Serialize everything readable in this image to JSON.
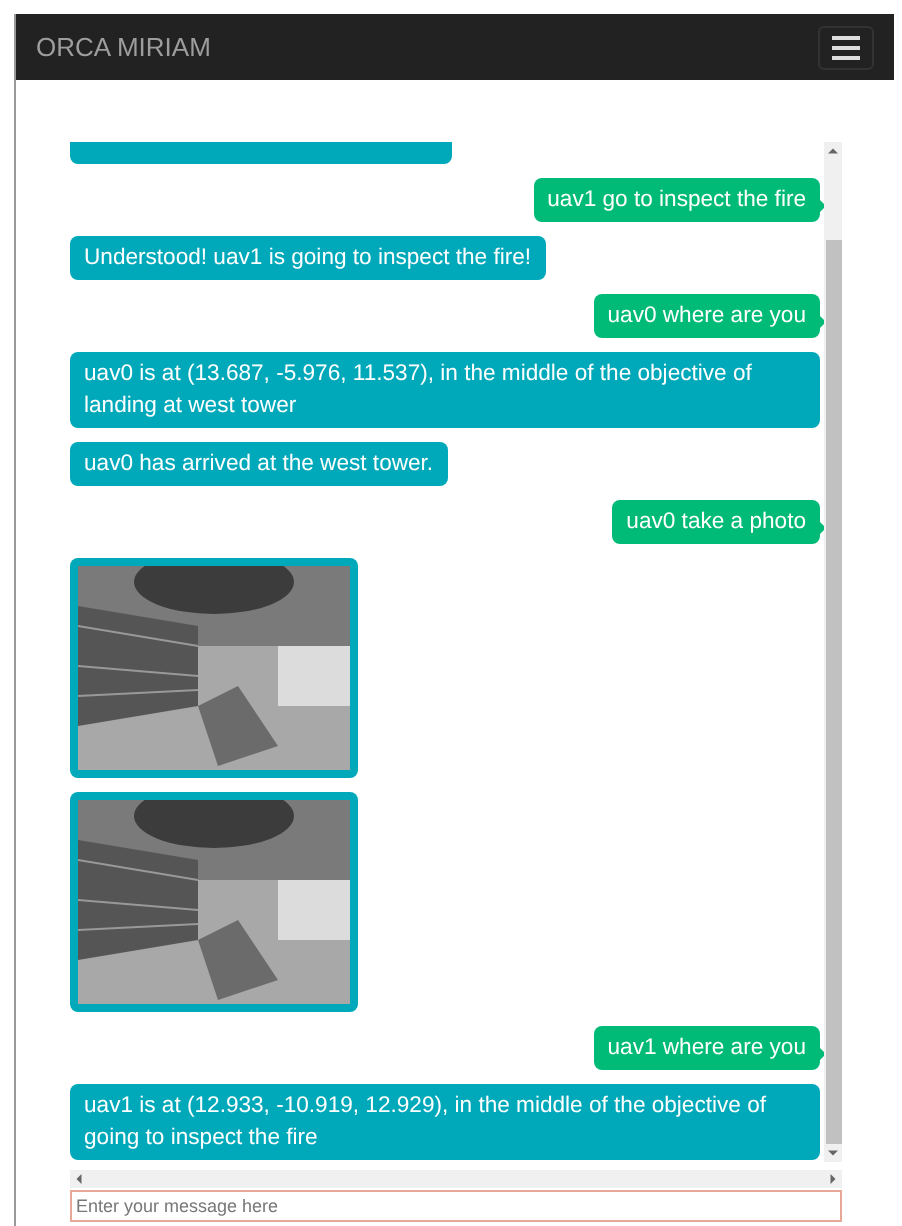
{
  "navbar": {
    "brand": "ORCA MIRIAM"
  },
  "messages": [
    {
      "kind": "clipped"
    },
    {
      "kind": "sent",
      "text": "uav1 go to inspect the fire"
    },
    {
      "kind": "received",
      "text": "Understood! uav1 is going to inspect the fire!"
    },
    {
      "kind": "sent",
      "text": "uav0 where are you"
    },
    {
      "kind": "received",
      "text": "uav0 is at (13.687, -5.976, 11.537), in the middle of the objective of landing at west tower"
    },
    {
      "kind": "received",
      "text": "uav0 has arrived at the west tower."
    },
    {
      "kind": "sent",
      "text": "uav0 take a photo"
    },
    {
      "kind": "picture"
    },
    {
      "kind": "picture"
    },
    {
      "kind": "sent",
      "text": "uav1 where are you"
    },
    {
      "kind": "received",
      "text": "uav1 is at (12.933, -10.919, 12.929), in the middle of the objective of going to inspect the fire"
    }
  ],
  "input": {
    "placeholder": "Enter your message here"
  }
}
